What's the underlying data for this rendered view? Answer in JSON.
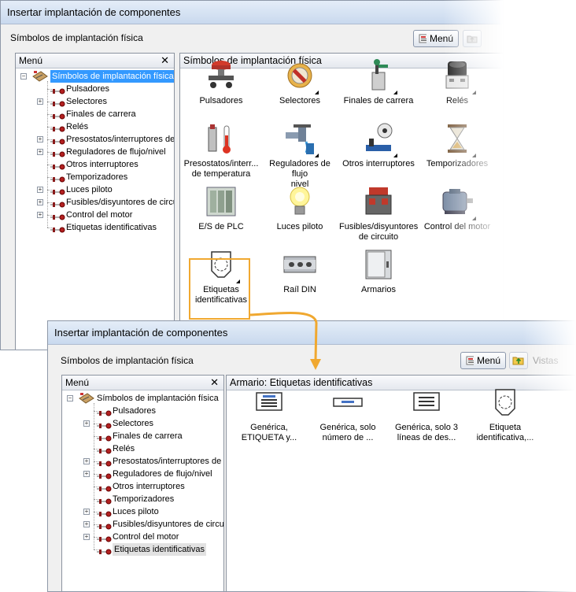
{
  "window1": {
    "title": "Insertar implantación de componentes",
    "subtitle": "Símbolos de implantación física",
    "menu_button_label": "Menú",
    "left_panel": {
      "header": "Menú",
      "root_label": "Símbolos de implantación física",
      "items": [
        "Pulsadores",
        "Selectores",
        "Finales de carrera",
        "Relés",
        "Presostatos/interruptores de te",
        "Reguladores de flujo/nivel",
        "Otros interruptores",
        "Temporizadores",
        "Luces piloto",
        "Fusibles/disyuntores de circuit",
        "Control del motor",
        "Etiquetas identificativas"
      ]
    },
    "right_panel": {
      "header": "Símbolos de implantación física",
      "gallery": [
        [
          "Pulsadores"
        ],
        [
          "Selectores"
        ],
        [
          "Finales de carrera"
        ],
        [
          "Relés"
        ],
        [
          "Presostatos/interr...",
          "de temperatura"
        ],
        [
          "Reguladores de flujo",
          "nivel"
        ],
        [
          "Otros interruptores"
        ],
        [
          "Temporizadores"
        ],
        [
          "E/S de PLC"
        ],
        [
          "Luces piloto"
        ],
        [
          "Fusibles/disyuntores",
          "de circuito"
        ],
        [
          "Control del motor"
        ],
        [
          "Etiquetas",
          "identificativas"
        ],
        [
          "Raíl DIN"
        ],
        [
          "Armarios"
        ]
      ]
    }
  },
  "window2": {
    "title": "Insertar implantación de componentes",
    "subtitle": "Símbolos de implantación física",
    "menu_button_label": "Menú",
    "views_label": "Vistas",
    "left_panel": {
      "header": "Menú",
      "root_label": "Símbolos de implantación física",
      "items": [
        "Pulsadores",
        "Selectores",
        "Finales de carrera",
        "Relés",
        "Presostatos/interruptores de te",
        "Reguladores de flujo/nivel",
        "Otros interruptores",
        "Temporizadores",
        "Luces piloto",
        "Fusibles/disyuntores de circuit",
        "Control del motor",
        "Etiquetas identificativas"
      ]
    },
    "right_panel": {
      "header": "Armario: Etiquetas identificativas",
      "gallery": [
        [
          "Genérica,",
          "ETIQUETA y..."
        ],
        [
          "Genérica, solo",
          "número de ..."
        ],
        [
          "Genérica, solo 3",
          "líneas de des..."
        ],
        [
          "Etiqueta",
          "identificativa,..."
        ]
      ]
    }
  },
  "colors": {
    "selection": "#3399ff",
    "highlight": "#f0a830",
    "callout_arrow": "#f0a830"
  }
}
